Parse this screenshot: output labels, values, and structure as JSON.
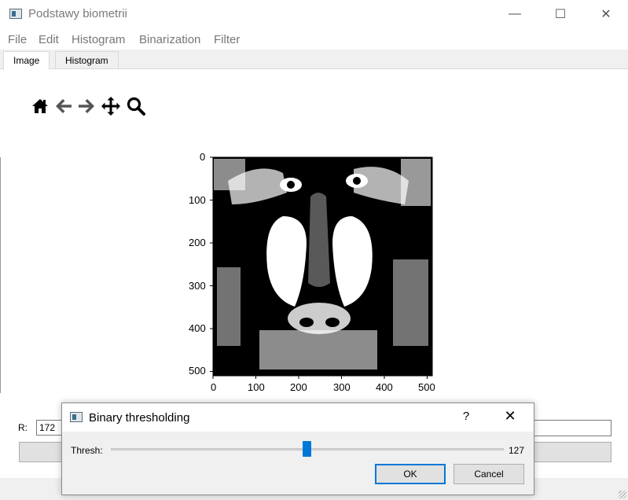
{
  "window": {
    "title": "Podstawy biometrii",
    "minimize": "—",
    "maximize": "☐",
    "close": "✕"
  },
  "menubar": {
    "items": [
      "File",
      "Edit",
      "Histogram",
      "Binarization",
      "Filter"
    ]
  },
  "tabs": [
    {
      "label": "Image",
      "active": true
    },
    {
      "label": "Histogram",
      "active": false
    }
  ],
  "toolbar": {
    "icons": [
      "home-icon",
      "back-arrow-icon",
      "forward-arrow-icon",
      "pan-move-icon",
      "zoom-icon"
    ]
  },
  "plot": {
    "y_ticks": [
      "0",
      "100",
      "200",
      "300",
      "400",
      "500"
    ],
    "x_ticks": [
      "0",
      "100",
      "200",
      "300",
      "400",
      "500"
    ]
  },
  "controls": {
    "r_label": "R:",
    "r_value": "172"
  },
  "dialog": {
    "title": "Binary thresholding",
    "help": "?",
    "close": "✕",
    "thresh_label": "Thresh:",
    "thresh_value": "127",
    "thresh_min": 0,
    "thresh_max": 255,
    "ok_label": "OK",
    "cancel_label": "Cancel"
  },
  "colors": {
    "accent": "#0078d7",
    "dialog_bg": "#f0f0f0"
  }
}
